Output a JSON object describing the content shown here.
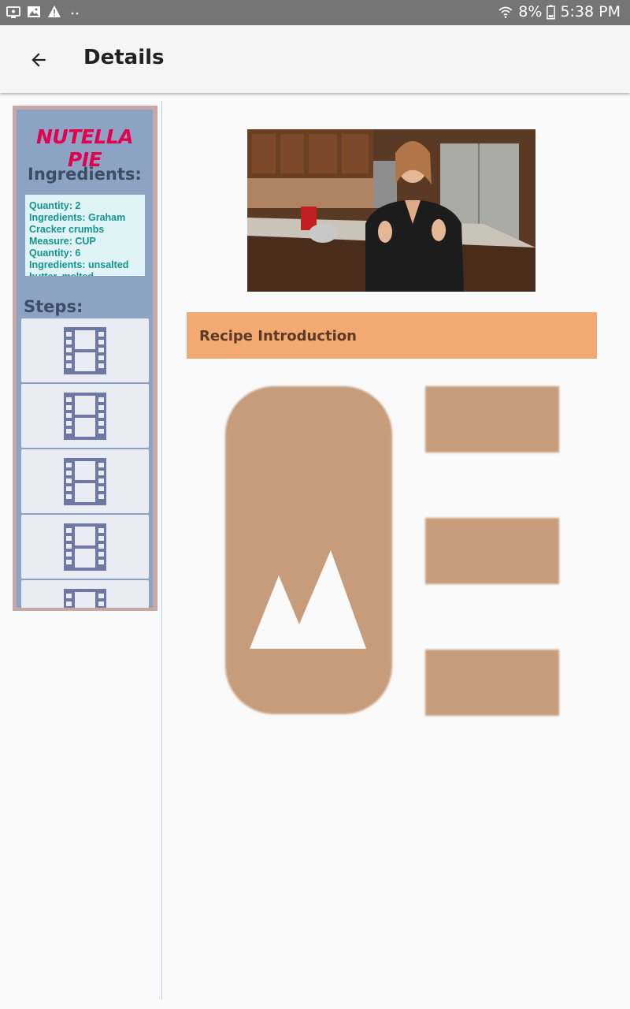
{
  "status_bar": {
    "battery": "8%",
    "time": "5:38 PM",
    "left_icons": [
      "screen-icon",
      "image-icon",
      "warning-icon",
      "more-dots-icon"
    ],
    "right_icons": [
      "wifi-icon",
      "battery-icon"
    ]
  },
  "app_bar": {
    "title": "Details",
    "back_icon": "arrow-back-icon"
  },
  "recipe": {
    "name": "NUTELLA PIE",
    "ingredients_heading": "Ingredients:",
    "ingredients_lines": [
      "Quantity: 2",
      "Ingredients: Graham Cracker crumbs",
      "Measure: CUP",
      "Quantity: 6",
      "Ingredients: unsalted butter, melted"
    ],
    "steps_heading": "Steps:",
    "step_icon": "film-strip-icon"
  },
  "detail": {
    "intro_label": "Recipe Introduction",
    "placeholder_icon": "image-list-placeholder-icon"
  },
  "colors": {
    "accent_title": "#e3004f",
    "panel_bg": "#8da3c3",
    "intro_bar": "#f3a972",
    "placeholder": "#c69c7b"
  }
}
